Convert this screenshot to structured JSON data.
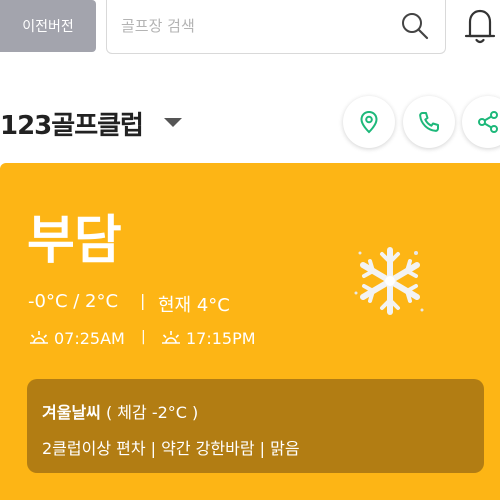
{
  "top_bar": {
    "prev_version_label": "이전버전",
    "search_placeholder": "골프장 검색",
    "search_value": ""
  },
  "header": {
    "club_name": "123골프클럽"
  },
  "weather": {
    "condition": "부담",
    "temp_range": "-0°C / 2°C",
    "separator": "|",
    "current_temp": "현재 4°C",
    "sunrise": "07:25AM",
    "sunset": "17:15PM",
    "icon": "snowflake-icon",
    "note_title": "겨울날씨",
    "note_feels_like": " ( 체감 -2°C )",
    "note_details": "2클럽이상 편차 | 약간 강한바람 | 맑음"
  },
  "colors": {
    "card_background": "#fdb515",
    "info_box_background": "#b27d13",
    "accent_green": "#1db87a",
    "prev_button_background": "#a3a4ad"
  }
}
